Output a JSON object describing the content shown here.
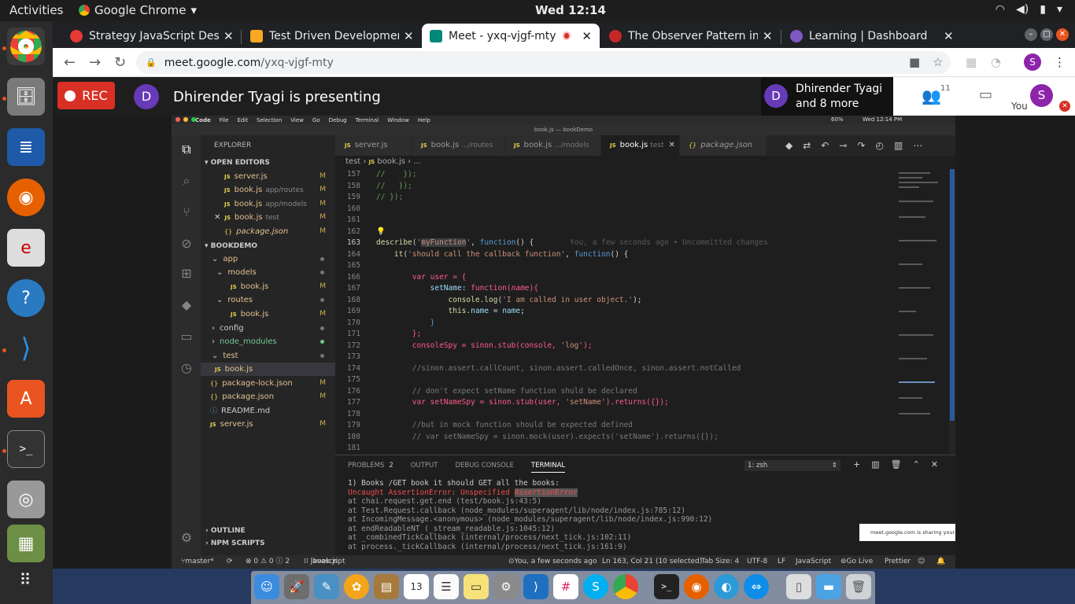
{
  "topbar": {
    "activities": "Activities",
    "app_name": "Google Chrome",
    "clock": "Wed 12:14"
  },
  "chrome": {
    "tabs": [
      {
        "label": "Strategy JavaScript Des",
        "favicon_color": "#e53935"
      },
      {
        "label": "Test Driven Developmen",
        "favicon_color": "#f9a825"
      },
      {
        "label": "Meet - yxq-vjgf-mty",
        "favicon_color": "#00897b"
      },
      {
        "label": "The Observer Pattern in",
        "favicon_color": "#c62828"
      },
      {
        "label": "Learning | Dashboard",
        "favicon_color": "#7e57c2"
      }
    ],
    "url_host": "meet.google.com",
    "url_path": "/yxq-vjgf-mty",
    "profile_initial": "S"
  },
  "meet": {
    "rec_label": "REC",
    "presenter_initial": "D",
    "presenting_text": "Dhirender Tyagi is presenting",
    "participant_initial": "D",
    "participant_line1": "Dhirender Tyagi",
    "participant_line2": "and 8 more",
    "people_count": "11",
    "you_label": "You",
    "self_initial": "S"
  },
  "vscode": {
    "mac_menu": [
      "Code",
      "File",
      "Edit",
      "Selection",
      "View",
      "Go",
      "Debug",
      "Terminal",
      "Window",
      "Help"
    ],
    "mac_time": "Wed 12:14 PM",
    "mac_battery": "60%",
    "window_title": "book.js — bookDemo",
    "explorer_title": "EXPLORER",
    "open_editors_title": "OPEN EDITORS",
    "open_editors": [
      {
        "icon": "JS",
        "name": "server.js",
        "sub": "",
        "badge": "M"
      },
      {
        "icon": "JS",
        "name": "book.js",
        "sub": "app/routes",
        "badge": "M"
      },
      {
        "icon": "JS",
        "name": "book.js",
        "sub": "app/models",
        "badge": "M"
      },
      {
        "icon": "JS",
        "name": "book.js",
        "sub": "test",
        "badge": "M"
      },
      {
        "icon": "{}",
        "name": "package.json",
        "sub": "",
        "badge": "M"
      }
    ],
    "project_title": "BOOKDEMO",
    "tree": [
      {
        "name": "app",
        "type": "folder",
        "badge": "dot"
      },
      {
        "name": "models",
        "type": "folder",
        "badge": "dot"
      },
      {
        "name": "book.js",
        "type": "js",
        "badge": "M"
      },
      {
        "name": "routes",
        "type": "folder",
        "badge": "dot"
      },
      {
        "name": "book.js",
        "type": "js",
        "badge": "M"
      },
      {
        "name": "config",
        "type": "folder",
        "badge": "dot"
      },
      {
        "name": "node_modules",
        "type": "folder",
        "badge": "dot"
      },
      {
        "name": "test",
        "type": "folder",
        "badge": "dot"
      },
      {
        "name": "book.js",
        "type": "js",
        "badge": ""
      },
      {
        "name": "package-lock.json",
        "type": "json",
        "badge": "M"
      },
      {
        "name": "package.json",
        "type": "json",
        "badge": "M"
      },
      {
        "name": "README.md",
        "type": "info",
        "badge": ""
      },
      {
        "name": "server.js",
        "type": "js",
        "badge": "M"
      }
    ],
    "outline_label": "OUTLINE",
    "npm_scripts_label": "NPM SCRIPTS",
    "editor_tabs": [
      {
        "icon": "JS",
        "name": "server.js",
        "sub": ""
      },
      {
        "icon": "JS",
        "name": "book.js",
        "sub": ".../routes"
      },
      {
        "icon": "JS",
        "name": "book.js",
        "sub": ".../models"
      },
      {
        "icon": "JS",
        "name": "book.js",
        "sub": "test"
      },
      {
        "icon": "{}",
        "name": "package.json",
        "sub": ""
      }
    ],
    "breadcrumb": [
      "test",
      "JS",
      "book.js",
      "..."
    ],
    "code_lines": [
      {
        "n": "157",
        "t": "//    });"
      },
      {
        "n": "158",
        "t": "//   });"
      },
      {
        "n": "159",
        "t": "// });"
      },
      {
        "n": "160",
        "t": ""
      },
      {
        "n": "161",
        "t": ""
      },
      {
        "n": "162",
        "t": ""
      },
      {
        "n": "163",
        "t": "describe('myFunction', function() {"
      },
      {
        "n": "164",
        "t": "    it('should call the callback function', function() {"
      },
      {
        "n": "165",
        "t": ""
      },
      {
        "n": "166",
        "t": "        var user = {"
      },
      {
        "n": "167",
        "t": "            setName: function(name){"
      },
      {
        "n": "168",
        "t": "                console.log('I am called in user object.');"
      },
      {
        "n": "169",
        "t": "                this.name = name;"
      },
      {
        "n": "170",
        "t": "            }"
      },
      {
        "n": "171",
        "t": "        };"
      },
      {
        "n": "172",
        "t": "        consoleSpy = sinon.stub(console, 'log');"
      },
      {
        "n": "173",
        "t": ""
      },
      {
        "n": "174",
        "t": "        //sinon.assert.callCount, sinon.assert.calledOnce, sinon.assert.notCalled"
      },
      {
        "n": "175",
        "t": ""
      },
      {
        "n": "176",
        "t": "        // don't expect setName function shuld be declared"
      },
      {
        "n": "177",
        "t": "        var setNameSpy = sinon.stub(user, 'setName').returns({});"
      },
      {
        "n": "178",
        "t": ""
      },
      {
        "n": "179",
        "t": "        //but in mock function should be expected defined"
      },
      {
        "n": "180",
        "t": "        // var setNameSpy = sinon.mock(user).expects('setName').returns({});"
      },
      {
        "n": "181",
        "t": ""
      }
    ],
    "blame": "You, a few seconds ago • Uncommitted changes",
    "panel_tabs": [
      "PROBLEMS",
      "OUTPUT",
      "DEBUG CONSOLE",
      "TERMINAL"
    ],
    "problems_count": "2",
    "terminal_select": "1: zsh",
    "terminal_lines": [
      "1) Books /GET book it should GET all the books:",
      "   Uncaught AssertionError: Unspecified AssertionError",
      "    at chai.request.get.end (test/book.js:43:5)",
      "    at Test.Request.callback (node_modules/superagent/lib/node/index.js:785:12)",
      "    at IncomingMessage.<anonymous> (node_modules/superagent/lib/node/index.js:990:12)",
      "    at endReadableNT (_stream_readable.js:1045:12)",
      "    at _combinedTickCallback (internal/process/next_tick.js:102:11)",
      "    at process._tickCallback (internal/process/next_tick.js:161:9)"
    ],
    "share_toast": "meet.google.com is sharing your s",
    "status": {
      "branch": "master*",
      "errors": "⊗ 0 ⚠ 0 ⓘ 2",
      "lang_crumb": "javascript",
      "file_crumb": "book.js",
      "blame": "You, a few seconds ago",
      "position": "Ln 163, Col 21 (10 selected)",
      "tab_size": "Tab Size: 4",
      "encoding": "UTF-8",
      "eol": "LF",
      "language": "JavaScript",
      "golive": "Go Live",
      "prettier": "Prettier"
    }
  }
}
